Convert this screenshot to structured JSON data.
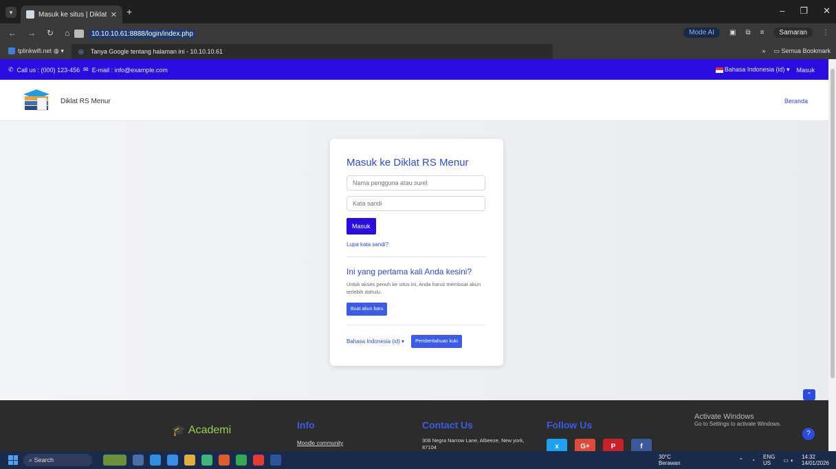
{
  "browser": {
    "tab_title": "Masuk ke situs | Diklat RS Menu",
    "url": "10.10.10.61:8888/login/index.php",
    "mode_ai": "Mode AI",
    "profile": "Samaran",
    "suggestion": "Tanya Google tentang halaman ini - 10.10.10.61",
    "bookmark_1": "tplinkwifi.net",
    "bookmarks_folder": "Semua Bookmark"
  },
  "topbar": {
    "contact": "Call us : (000) 123-456",
    "email": "E-mail : info@example.com",
    "language": "Bahasa Indonesia (id)",
    "login": "Masuk"
  },
  "header": {
    "brand": "Diklat RS Menur",
    "home": "Beranda"
  },
  "login_card": {
    "title": "Masuk ke Diklat RS Menur",
    "username_placeholder": "Nama pengguna atau surel",
    "password_placeholder": "Kata sandi",
    "login_button": "Masuk",
    "forgot": "Lupa kata sandi?",
    "first_time_title": "Ini yang pertama kali Anda kesini?",
    "first_time_desc": "Untuk akses penuh ke situs ini, Anda harus membuat akun terlebih dahulu.",
    "create_account": "Buat akun baru",
    "language": "Bahasa Indonesia (id)",
    "cookie_notice": "Pemberitahuan kuki"
  },
  "footer": {
    "academi": "Academi",
    "info_title": "Info",
    "info_link": "Moodle community",
    "contact_title": "Contact Us",
    "address": "308 Negra Narrow Lane, Albeeze, New york, 87104",
    "follow_title": "Follow Us",
    "socials": [
      "x",
      "G+",
      "P",
      "f"
    ]
  },
  "windows": {
    "activate_title": "Activate Windows",
    "activate_sub": "Go to Settings to activate Windows.",
    "search": "Search",
    "temp": "30°C",
    "weather": "Berawan",
    "lang_top": "ENG",
    "lang_bottom": "US",
    "time": "14:32",
    "date": "14/01/2026"
  },
  "colors": {
    "primary": "#2b0ce0",
    "link": "#2b4ce0",
    "footer_bg": "#2c2c2c"
  }
}
